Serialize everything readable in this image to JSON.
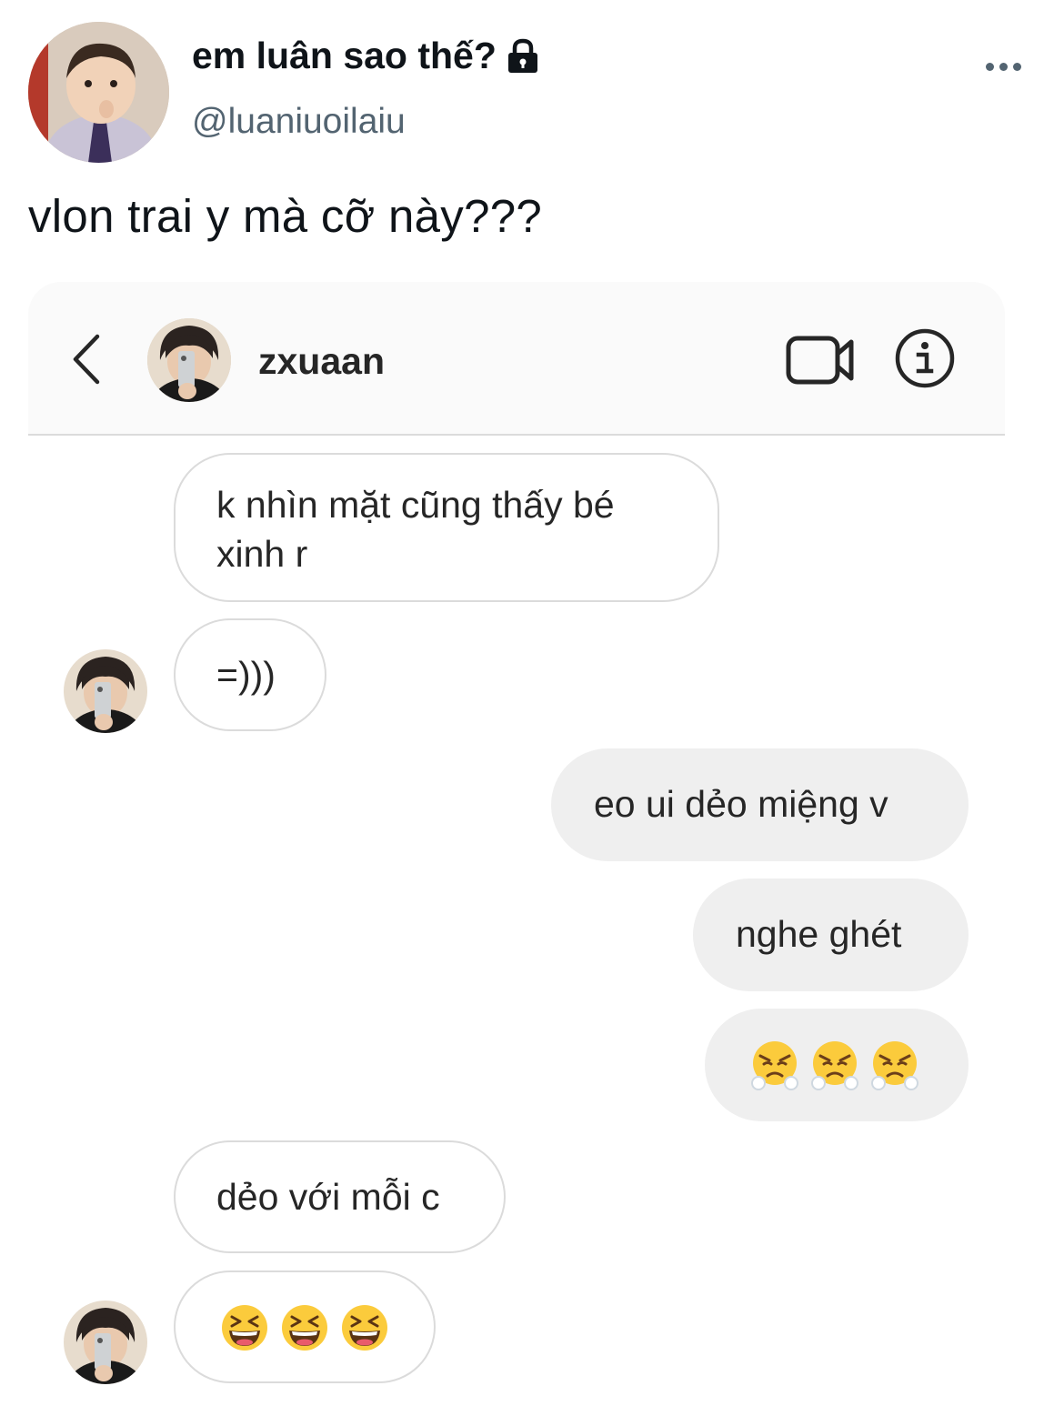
{
  "tweet": {
    "display_name": "em luân sao thế?",
    "handle": "@luaniuoilaiu",
    "text": "vlon trai y mà cỡ này???",
    "avatar_icon": "profile-photo-child",
    "locked_icon": "lock-icon",
    "more_icon": "more-horizontal-icon"
  },
  "dm": {
    "username": "zxuaan",
    "header_icons": [
      "back-chevron-icon",
      "video-call-icon",
      "info-icon"
    ],
    "messages": [
      {
        "from": "them",
        "lines": [
          "k nhìn mặt cũng thấy bé",
          "xinh r"
        ]
      },
      {
        "from": "them",
        "text": "=)))"
      },
      {
        "from": "me",
        "text": "eo ui dẻo miệng v"
      },
      {
        "from": "me",
        "text": "nghe ghét"
      },
      {
        "from": "me",
        "emoji": [
          "face-with-steam-from-nose",
          "face-with-steam-from-nose",
          "face-with-steam-from-nose"
        ]
      },
      {
        "from": "them",
        "text": "dẻo với mỗi c"
      },
      {
        "from": "them",
        "emoji": [
          "grinning-squinting-face",
          "grinning-squinting-face",
          "grinning-squinting-face"
        ]
      }
    ]
  }
}
